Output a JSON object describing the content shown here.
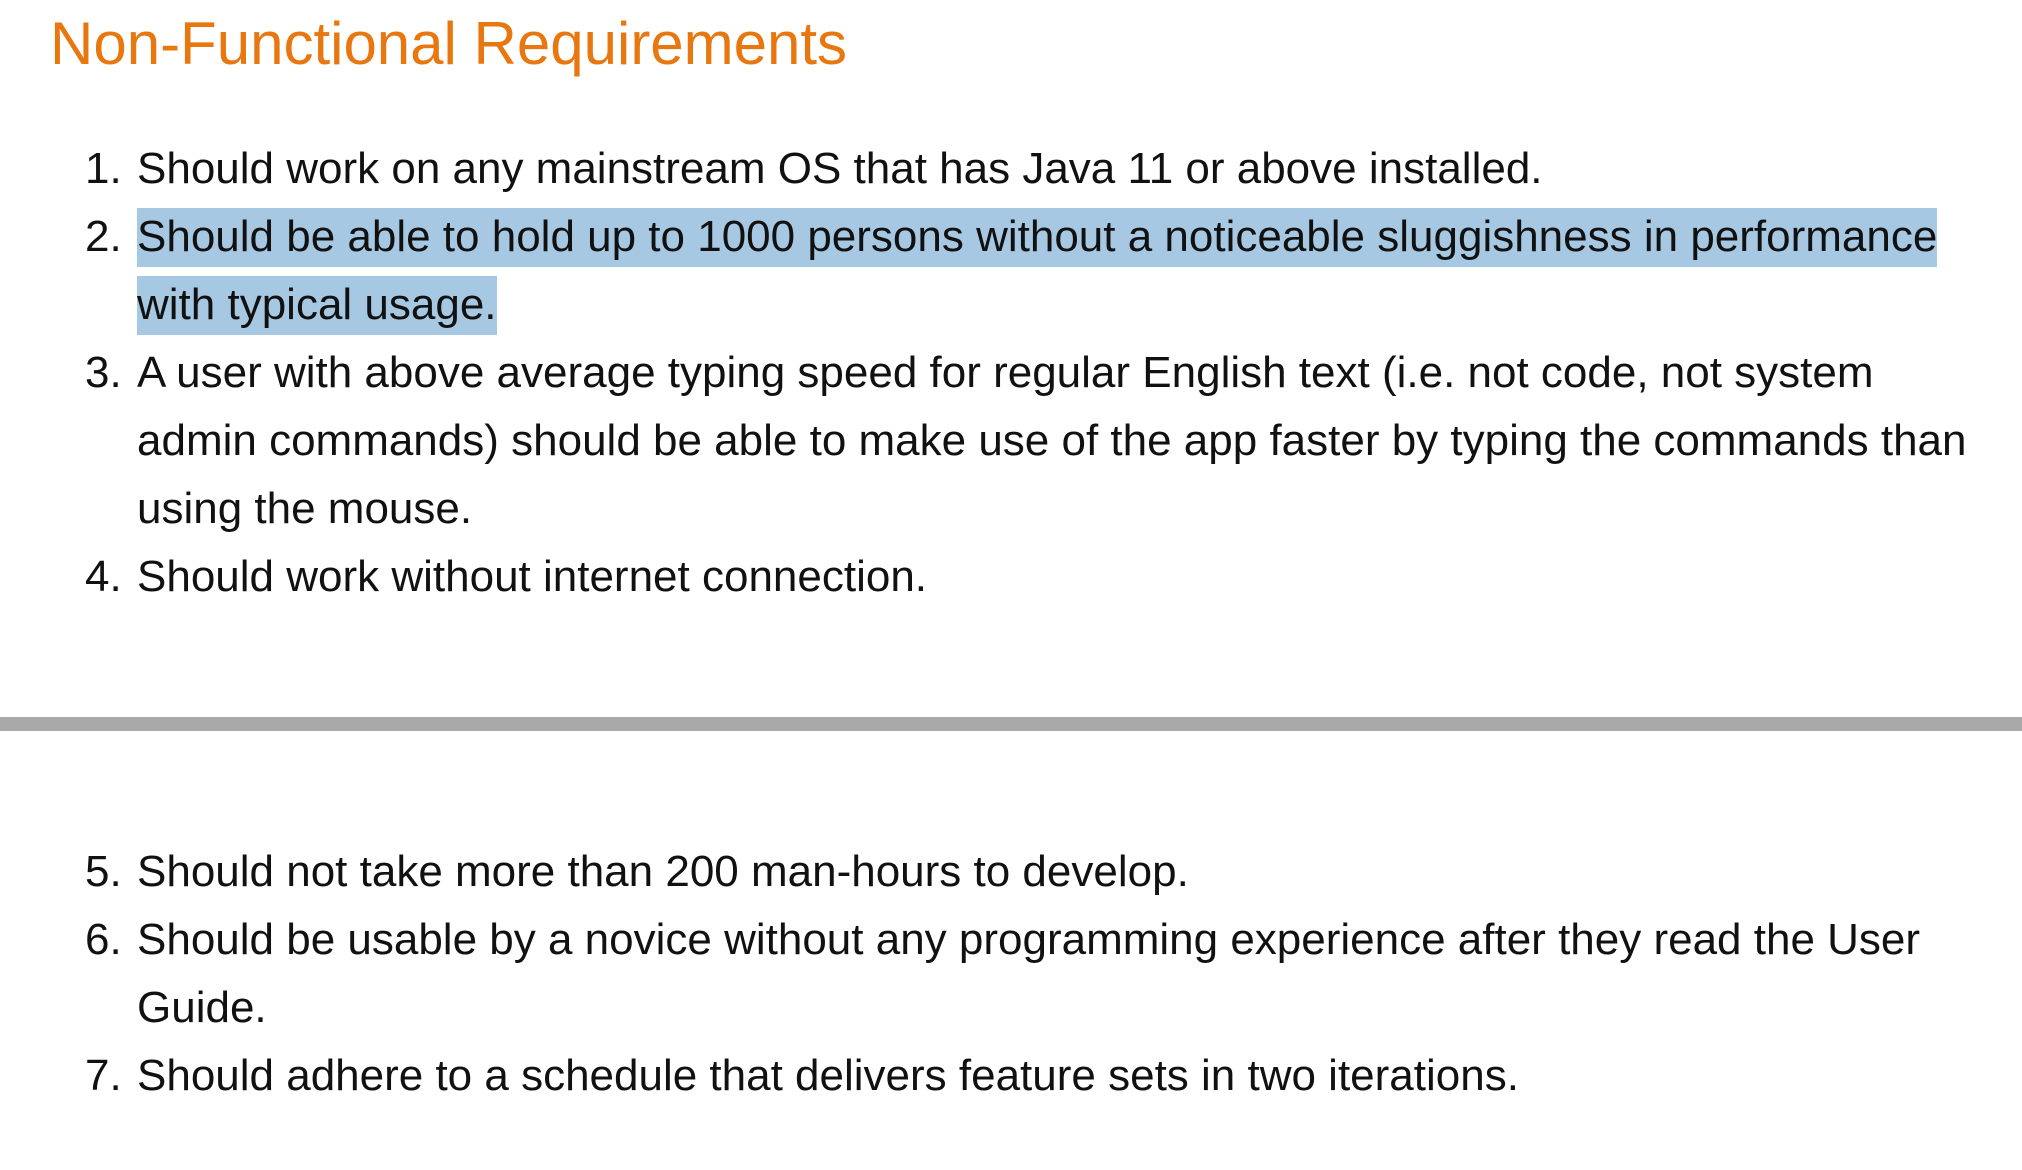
{
  "heading": {
    "text": "Non-Functional Requirements",
    "color": "#e8770f"
  },
  "selection_color": "#a6c8e2",
  "requirements_part1": [
    {
      "number": "1.",
      "text": "Should work on any mainstream OS that has Java 11 or above installed."
    },
    {
      "number": "2.",
      "text": "Should be able to hold up to 1000 persons without a noticeable sluggishness in performance with typical usage."
    },
    {
      "number": "3.",
      "text": "A user with above average typing speed for regular English text (i.e. not code, not system admin commands) should be able to make use of the app faster by typing the commands than using the mouse."
    },
    {
      "number": "4.",
      "text": "Should work without internet connection."
    }
  ],
  "requirements_part2": [
    {
      "number": "5.",
      "text": "Should not take more than 200 man-hours to develop."
    },
    {
      "number": "6.",
      "text": "Should be usable by a novice without any programming experience after they read the User Guide."
    },
    {
      "number": "7.",
      "text": "Should adhere to a schedule that delivers feature sets in two iterations."
    }
  ]
}
